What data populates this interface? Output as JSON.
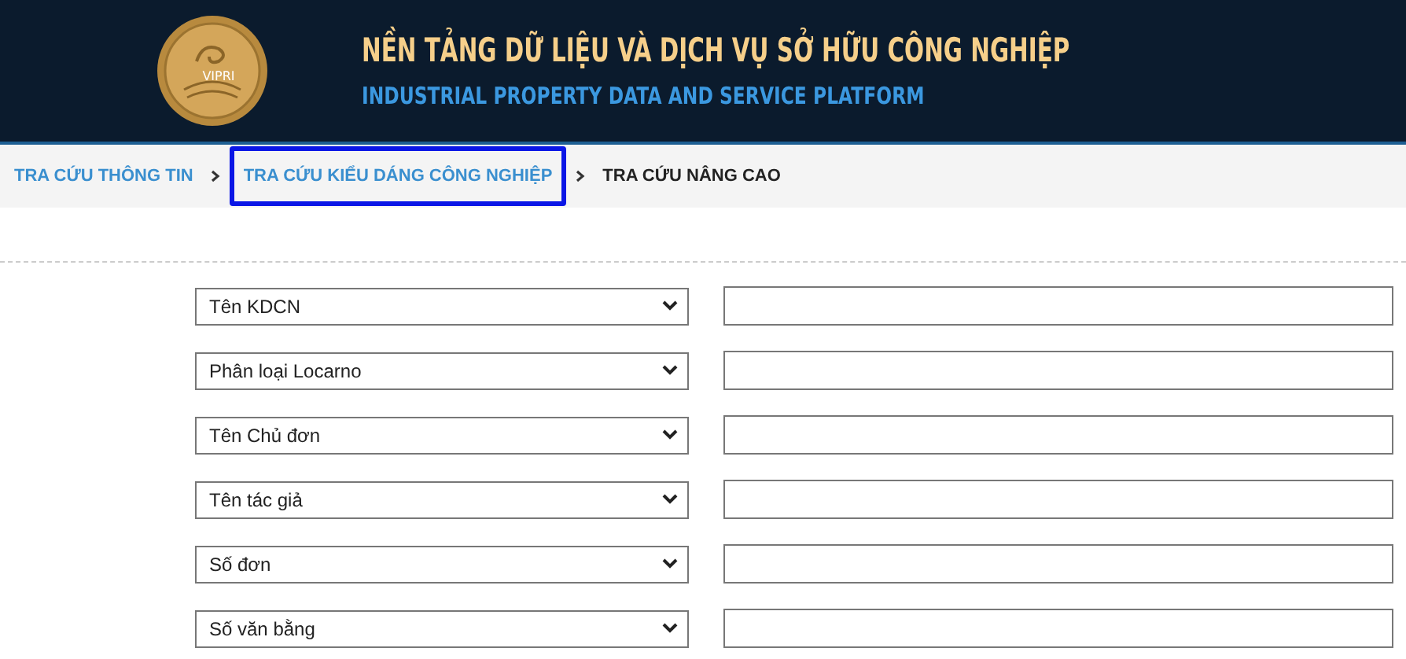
{
  "header": {
    "logo_text": "VIPRI",
    "title": "NỀN TẢNG DỮ LIỆU VÀ DỊCH VỤ SỞ HỮU CÔNG NGHIỆP",
    "subtitle": "INDUSTRIAL PROPERTY DATA AND SERVICE PLATFORM"
  },
  "breadcrumb": [
    {
      "label": "TRA CỨU THÔNG TIN",
      "current": false,
      "highlighted": false
    },
    {
      "label": "TRA CỨU KIỂU DÁNG CÔNG NGHIỆP",
      "current": false,
      "highlighted": true
    },
    {
      "label": "TRA CỨU NÂNG CAO",
      "current": true,
      "highlighted": false
    }
  ],
  "search_rows": [
    {
      "field": "Tên KDCN"
    },
    {
      "field": "Phân loại Locarno"
    },
    {
      "field": "Tên Chủ đơn"
    },
    {
      "field": "Tên tác giả"
    },
    {
      "field": "Số đơn"
    },
    {
      "field": "Số văn bằng"
    }
  ]
}
